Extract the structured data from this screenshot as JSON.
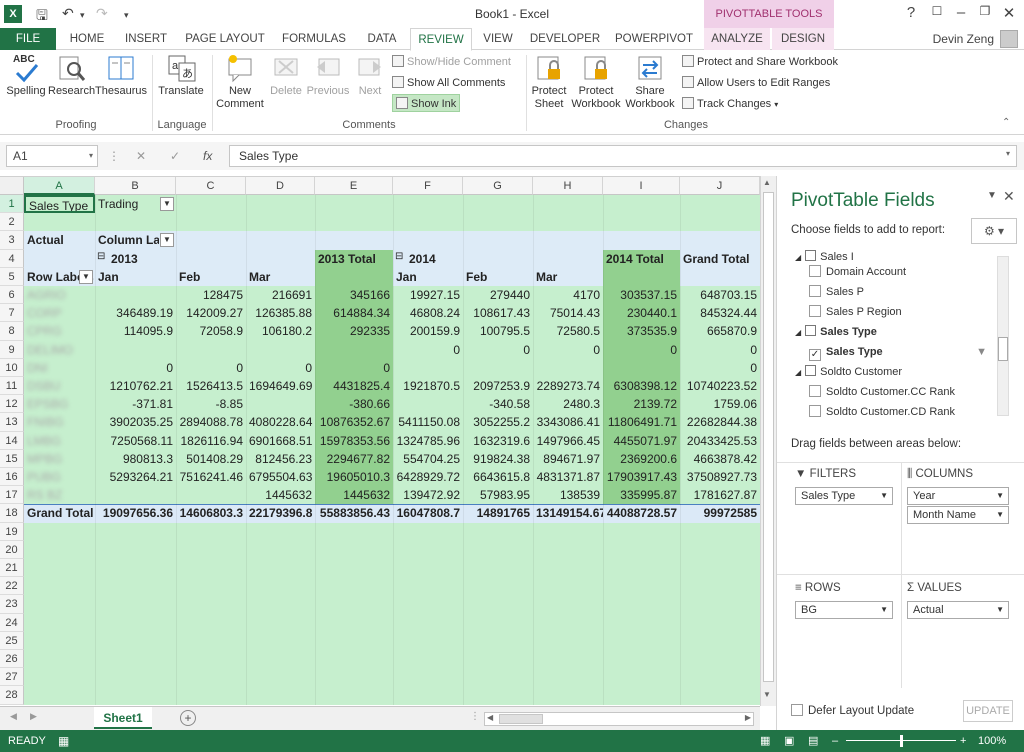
{
  "window": {
    "title": "Book1 - Excel",
    "user": "Devin Zeng",
    "context_tab_group": "PIVOTTABLE TOOLS",
    "app_icon_letter": "X"
  },
  "tabs": [
    {
      "label": "FILE"
    },
    {
      "label": "HOME"
    },
    {
      "label": "INSERT"
    },
    {
      "label": "PAGE LAYOUT"
    },
    {
      "label": "FORMULAS"
    },
    {
      "label": "DATA"
    },
    {
      "label": "REVIEW"
    },
    {
      "label": "VIEW"
    },
    {
      "label": "DEVELOPER"
    },
    {
      "label": "POWERPIVOT"
    },
    {
      "label": "ANALYZE"
    },
    {
      "label": "DESIGN"
    }
  ],
  "ribbon": {
    "proofing": {
      "spelling": "Spelling",
      "research": "Research",
      "thesaurus": "Thesaurus",
      "group": "Proofing",
      "abc": "ABC"
    },
    "language": {
      "translate": "Translate",
      "group": "Language"
    },
    "comments": {
      "new_line1": "New",
      "new_line2": "Comment",
      "delete": "Delete",
      "previous": "Previous",
      "next": "Next",
      "show_hide": "Show/Hide Comment",
      "show_all": "Show All Comments",
      "show_ink": "Show Ink",
      "group": "Comments"
    },
    "changes": {
      "protect_sheet_1": "Protect",
      "protect_sheet_2": "Sheet",
      "protect_wb_1": "Protect",
      "protect_wb_2": "Workbook",
      "share_wb_1": "Share",
      "share_wb_2": "Workbook",
      "protect_share": "Protect and Share Workbook",
      "allow_users": "Allow Users to Edit Ranges",
      "track_changes": "Track Changes",
      "group": "Changes"
    }
  },
  "formula_bar": {
    "name_box": "A1",
    "formula": "Sales Type",
    "fx": "fx"
  },
  "columns": [
    "A",
    "B",
    "C",
    "D",
    "E",
    "F",
    "G",
    "H",
    "I",
    "J"
  ],
  "rows": [
    "1",
    "2",
    "3",
    "4",
    "5",
    "6",
    "7",
    "8",
    "9",
    "10",
    "11",
    "12",
    "13",
    "14",
    "15",
    "16",
    "17",
    "18",
    "19",
    "20",
    "21",
    "22",
    "23",
    "24",
    "25",
    "26",
    "27",
    "28"
  ],
  "pivot": {
    "filter_label": "Sales Type",
    "filter_value": "Trading",
    "values_label": "Actual",
    "col_labels": "Column Labels",
    "row_labels": "Row Labels",
    "year1": "2013",
    "year2": "2014",
    "total1": "2013 Total",
    "total2": "2014 Total",
    "grand_total": "Grand Total",
    "months": [
      "Jan",
      "Feb",
      "Mar"
    ],
    "data": [
      {
        "label": "AGRIO",
        "v": [
          "",
          "128475",
          "216691",
          "345166",
          "19927.15",
          "279440",
          "4170",
          "303537.15",
          "648703.15"
        ]
      },
      {
        "label": "CORP",
        "v": [
          "346489.19",
          "142009.27",
          "126385.88",
          "614884.34",
          "46808.24",
          "108617.43",
          "75014.43",
          "230440.1",
          "845324.44"
        ]
      },
      {
        "label": "CPRG",
        "v": [
          "114095.9",
          "72058.9",
          "106180.2",
          "292335",
          "200159.9",
          "100795.5",
          "72580.5",
          "373535.9",
          "665870.9"
        ]
      },
      {
        "label": "DELIMO",
        "v": [
          "",
          "",
          "",
          "",
          "0",
          "0",
          "0",
          "0",
          "0"
        ]
      },
      {
        "label": "DNI",
        "v": [
          "0",
          "0",
          "0",
          "0",
          "",
          "",
          "",
          "",
          "0"
        ]
      },
      {
        "label": "DSBU",
        "v": [
          "1210762.21",
          "1526413.5",
          "1694649.69",
          "4431825.4",
          "1921870.5",
          "2097253.9",
          "2289273.74",
          "6308398.12",
          "10740223.52"
        ]
      },
      {
        "label": "EPSBG",
        "v": [
          "-371.81",
          "-8.85",
          "",
          "-380.66",
          "",
          "-340.58",
          "2480.3",
          "2139.72",
          "1759.06"
        ]
      },
      {
        "label": "FNIBG",
        "v": [
          "3902035.25",
          "2894088.78",
          "4080228.64",
          "10876352.67",
          "5411150.08",
          "3052255.2",
          "3343086.41",
          "11806491.71",
          "22682844.38"
        ]
      },
      {
        "label": "LMBG",
        "v": [
          "7250568.11",
          "1826116.94",
          "6901668.51",
          "15978353.56",
          "1324785.96",
          "1632319.6",
          "1497966.45",
          "4455071.97",
          "20433425.53"
        ]
      },
      {
        "label": "MPBG",
        "v": [
          "980813.3",
          "501408.29",
          "812456.23",
          "2294677.82",
          "554704.25",
          "919824.38",
          "894671.97",
          "2369200.6",
          "4663878.42"
        ]
      },
      {
        "label": "PUBG",
        "v": [
          "5293264.21",
          "7516241.46",
          "6795504.63",
          "19605010.3",
          "6428929.72",
          "6643615.8",
          "4831371.87",
          "17903917.43",
          "37508927.73"
        ]
      },
      {
        "label": "RS BZ",
        "v": [
          "",
          "",
          "1445632",
          "1445632",
          "139472.92",
          "57983.95",
          "138539",
          "335995.87",
          "1781627.87"
        ]
      }
    ],
    "grand": [
      "19097656.36",
      "14606803.3",
      "22179396.8",
      "55883856.43",
      "16047808.7",
      "14891765",
      "13149154.67",
      "44088728.57",
      "99972585"
    ]
  },
  "sheet_tab": "Sheet1",
  "pane": {
    "title": "PivotTable Fields",
    "subtitle": "Choose fields to add to report:",
    "fields": [
      {
        "text": "Sales I",
        "type": "table-partial"
      },
      {
        "text": "Domain Account",
        "type": "field",
        "checked": false
      },
      {
        "text": "Sales P",
        "type": "field",
        "checked": false
      },
      {
        "text": "Sales P Region",
        "type": "field",
        "checked": false
      },
      {
        "text": "Sales Type",
        "type": "table"
      },
      {
        "text": "Sales Type",
        "type": "field",
        "checked": true
      },
      {
        "text": "Soldto Customer",
        "type": "table"
      },
      {
        "text": "Soldto Customer.CC Rank",
        "type": "field",
        "checked": false
      },
      {
        "text": "Soldto Customer.CD Rank",
        "type": "field",
        "checked": false
      }
    ],
    "drag_hint": "Drag fields between areas below:",
    "filters": "FILTERS",
    "columns": "COLUMNS",
    "rows": "ROWS",
    "values": "VALUES",
    "filter_item": "Sales Type",
    "col_item1": "Year",
    "col_item2": "Month Name",
    "row_item": "BG",
    "value_item": "Actual",
    "defer": "Defer Layout Update",
    "update": "UPDATE"
  },
  "status": {
    "ready": "READY",
    "zoom": "100%"
  },
  "colors": {
    "accent": "#217346",
    "pivot_green": "#c6efce",
    "pivot_total": "#92d08f",
    "pivot_blue": "#ddebf7"
  }
}
